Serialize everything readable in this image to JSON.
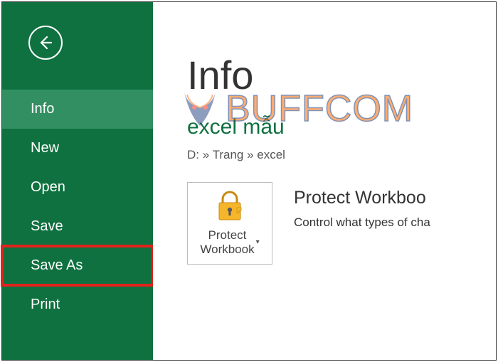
{
  "sidebar": {
    "items": [
      {
        "label": "Info"
      },
      {
        "label": "New"
      },
      {
        "label": "Open"
      },
      {
        "label": "Save"
      },
      {
        "label": "Save As"
      },
      {
        "label": "Print"
      }
    ]
  },
  "content": {
    "page_title": "Info",
    "file_name": "excel mẫu",
    "file_path": "D: » Trang » excel",
    "protect_button_line1": "Protect",
    "protect_button_line2": "Workbook",
    "protect_heading": "Protect Workboo",
    "protect_desc": "Control what types of cha"
  },
  "watermark": {
    "text": "BUFFCOM"
  }
}
